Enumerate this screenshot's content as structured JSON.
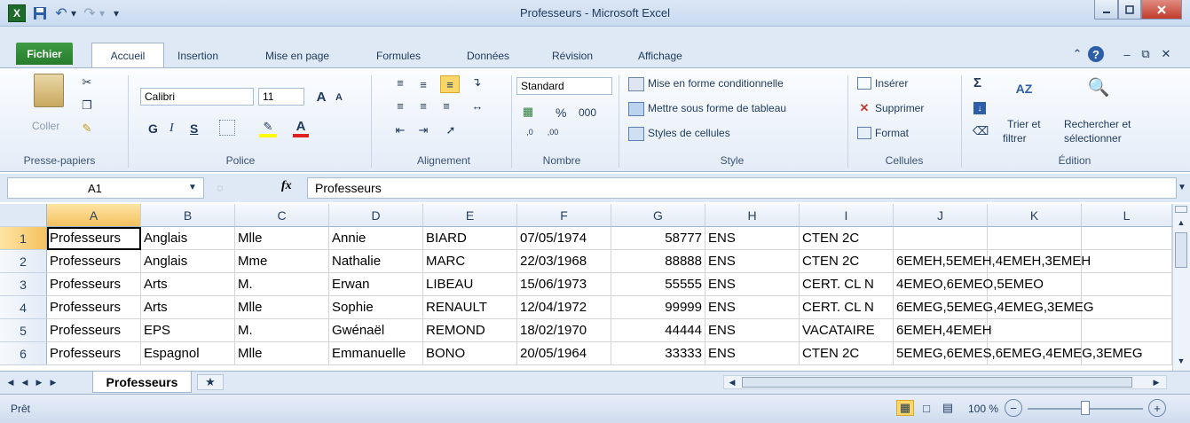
{
  "window": {
    "title": "Professeurs - Microsoft Excel",
    "min_icon": "minimize-icon",
    "max_icon": "restore-icon",
    "close_icon": "close-icon",
    "close_color": "#c23b2c"
  },
  "quick_access": {
    "excel_icon": "X",
    "save_icon": "save-icon",
    "undo_glyph": "↶",
    "redo_glyph": "↷",
    "customize_glyph": "▾"
  },
  "tabs": {
    "fichier": "Fichier",
    "accueil": "Accueil",
    "insertion": "Insertion",
    "mise_en_page": "Mise en page",
    "formules": "Formules",
    "donnees": "Données",
    "revision": "Révision",
    "affichage": "Affichage",
    "fichier_color": "#2f8a34"
  },
  "ribbon": {
    "clipboard": {
      "coller": "Coller",
      "group": "Presse-papiers"
    },
    "police": {
      "font": "Calibri",
      "size": "11",
      "bold": "G",
      "italic": "I",
      "underline": "S",
      "group": "Police"
    },
    "alignement": {
      "group": "Alignement"
    },
    "nombre": {
      "format": "Standard",
      "percent": "%",
      "thousands": "000",
      "group": "Nombre"
    },
    "style": {
      "mise_en_forme": "Mise en forme conditionnelle",
      "sous_forme_tableau": "Mettre sous forme de tableau",
      "styles_cellules": "Styles de cellules",
      "group": "Style"
    },
    "cellules": {
      "inserer": "Insérer",
      "supprimer": "Supprimer",
      "format": "Format",
      "group": "Cellules"
    },
    "edition": {
      "sigma": "Σ",
      "trier_1": "Trier et",
      "trier_2": "filtrer",
      "rechercher_1": "Rechercher et",
      "rechercher_2": "sélectionner",
      "group": "Édition"
    }
  },
  "formula_bar": {
    "name_box": "A1",
    "fx": "fx",
    "content": "Professeurs"
  },
  "columns": [
    "A",
    "B",
    "C",
    "D",
    "E",
    "F",
    "G",
    "H",
    "I",
    "J",
    "K",
    "L"
  ],
  "rows": [
    {
      "n": "1",
      "a": "Professeurs",
      "b": "Anglais",
      "c": "Mlle",
      "d": "Annie",
      "e": "BIARD",
      "f": "07/05/1974",
      "g": "58777",
      "h": "ENS",
      "i": "CTEN 2C",
      "j": ""
    },
    {
      "n": "2",
      "a": "Professeurs",
      "b": "Anglais",
      "c": "Mme",
      "d": "Nathalie",
      "e": "MARC",
      "f": "22/03/1968",
      "g": "88888",
      "h": "ENS",
      "i": "CTEN 2C",
      "j": "6EMEH,5EMEH,4EMEH,3EMEH"
    },
    {
      "n": "3",
      "a": "Professeurs",
      "b": "Arts",
      "c": "M.",
      "d": "Erwan",
      "e": "LIBEAU",
      "f": "15/06/1973",
      "g": "55555",
      "h": "ENS",
      "i": "CERT. CL N",
      "j": "4EMEO,6EMEO,5EMEO"
    },
    {
      "n": "4",
      "a": "Professeurs",
      "b": "Arts",
      "c": "Mlle",
      "d": "Sophie",
      "e": "RENAULT",
      "f": "12/04/1972",
      "g": "99999",
      "h": "ENS",
      "i": "CERT. CL N",
      "j": "6EMEG,5EMEG,4EMEG,3EMEG"
    },
    {
      "n": "5",
      "a": "Professeurs",
      "b": "EPS",
      "c": "M.",
      "d": "Gwénaël",
      "e": "REMOND",
      "f": "18/02/1970",
      "g": "44444",
      "h": "ENS",
      "i": "VACATAIRE",
      "j": "6EMEH,4EMEH"
    },
    {
      "n": "6",
      "a": "Professeurs",
      "b": "Espagnol",
      "c": "Mlle",
      "d": "Emmanuelle",
      "e": "BONO",
      "f": "20/05/1964",
      "g": "33333",
      "h": "ENS",
      "i": "CTEN 2C",
      "j": "5EMEG,6EMES,6EMEG,4EMEG,3EMEG"
    }
  ],
  "sheet": {
    "tab": "Professeurs"
  },
  "status": {
    "ready": "Prêt",
    "zoom": "100 %",
    "zoom_fraction": 0.5
  }
}
